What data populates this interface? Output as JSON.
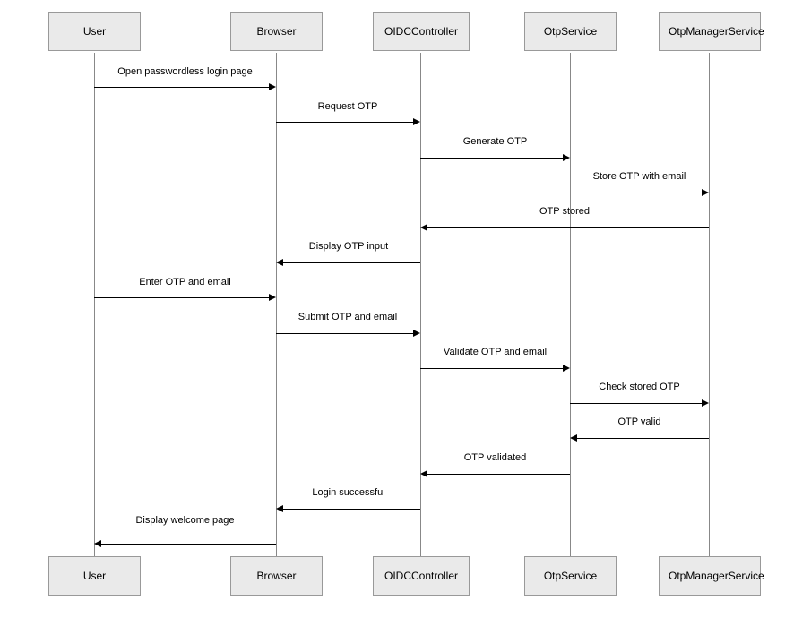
{
  "participants": {
    "user": "User",
    "browser": "Browser",
    "oidc": "OIDCController",
    "otp": "OtpService",
    "mgr": "OtpManagerService"
  },
  "messages": {
    "m1": "Open passwordless login page",
    "m2": "Request OTP",
    "m3": "Generate OTP",
    "m4": "Store OTP with email",
    "m5": "OTP stored",
    "m6": "Display OTP input",
    "m7": "Enter OTP and email",
    "m8": "Submit OTP and email",
    "m9": "Validate OTP and email",
    "m10": "Check stored OTP",
    "m11": "OTP valid",
    "m12": "OTP validated",
    "m13": "Login successful",
    "m14": "Display welcome page"
  },
  "chart_data": {
    "type": "sequence-diagram",
    "participants": [
      "User",
      "Browser",
      "OIDCController",
      "OtpService",
      "OtpManagerService"
    ],
    "messages": [
      {
        "from": "User",
        "to": "Browser",
        "text": "Open passwordless login page"
      },
      {
        "from": "Browser",
        "to": "OIDCController",
        "text": "Request OTP"
      },
      {
        "from": "OIDCController",
        "to": "OtpService",
        "text": "Generate OTP"
      },
      {
        "from": "OtpService",
        "to": "OtpManagerService",
        "text": "Store OTP with email"
      },
      {
        "from": "OtpManagerService",
        "to": "OIDCController",
        "text": "OTP stored"
      },
      {
        "from": "OIDCController",
        "to": "Browser",
        "text": "Display OTP input"
      },
      {
        "from": "User",
        "to": "Browser",
        "text": "Enter OTP and email"
      },
      {
        "from": "Browser",
        "to": "OIDCController",
        "text": "Submit OTP and email"
      },
      {
        "from": "OIDCController",
        "to": "OtpService",
        "text": "Validate OTP and email"
      },
      {
        "from": "OtpService",
        "to": "OtpManagerService",
        "text": "Check stored OTP"
      },
      {
        "from": "OtpManagerService",
        "to": "OtpService",
        "text": "OTP valid"
      },
      {
        "from": "OtpService",
        "to": "OIDCController",
        "text": "OTP validated"
      },
      {
        "from": "OIDCController",
        "to": "Browser",
        "text": "Login successful"
      },
      {
        "from": "Browser",
        "to": "User",
        "text": "Display welcome page"
      }
    ]
  }
}
